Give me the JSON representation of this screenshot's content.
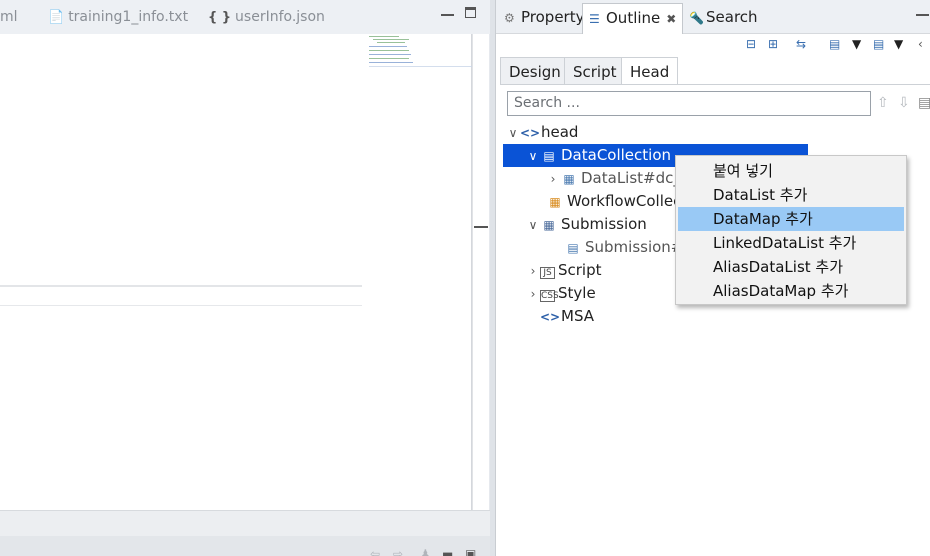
{
  "editor": {
    "tabs": [
      {
        "label": "ml",
        "icon": "xml-file-icon"
      },
      {
        "label": "training1_info.txt",
        "icon": "text-file-icon"
      },
      {
        "label": "userInfo.json",
        "icon": "json-file-icon"
      }
    ],
    "json_glyph": "{ }"
  },
  "views": {
    "tabs": [
      {
        "label": "Property",
        "icon": "property-icon"
      },
      {
        "label": "Outline",
        "icon": "outline-icon",
        "active": true
      },
      {
        "label": "Search",
        "icon": "search-icon"
      }
    ]
  },
  "outline": {
    "sub_tabs": [
      "Design",
      "Script",
      "Head"
    ],
    "active_sub_tab": "Head",
    "search_placeholder": "Search ...",
    "tree": [
      {
        "label": "head",
        "icon": "code-icon",
        "expanded": true
      },
      {
        "label": "DataCollection",
        "icon": "database-icon",
        "expanded": true,
        "selected": true
      },
      {
        "label": "DataList#dc_c",
        "icon": "datalist-icon",
        "expanded": false
      },
      {
        "label": "WorkflowCollec",
        "icon": "workflow-icon"
      },
      {
        "label": "Submission",
        "icon": "submission-icon",
        "expanded": true
      },
      {
        "label": "Submission#s",
        "icon": "submission-item-icon"
      },
      {
        "label": "Script",
        "icon": "js-icon",
        "expanded": false
      },
      {
        "label": "Style",
        "icon": "css-icon",
        "expanded": false
      },
      {
        "label": "MSA",
        "icon": "code-icon"
      }
    ]
  },
  "context_menu": {
    "items": [
      {
        "label": "붙여 넣기"
      },
      {
        "label": "DataList 추가"
      },
      {
        "label": "DataMap 추가",
        "highlighted": true
      },
      {
        "label": "LinkedDataList 추가"
      },
      {
        "label": "AliasDataList 추가"
      },
      {
        "label": "AliasDataMap 추가"
      }
    ]
  },
  "colors": {
    "selection": "#0a53d6",
    "menu_highlight": "#99c9f5"
  }
}
